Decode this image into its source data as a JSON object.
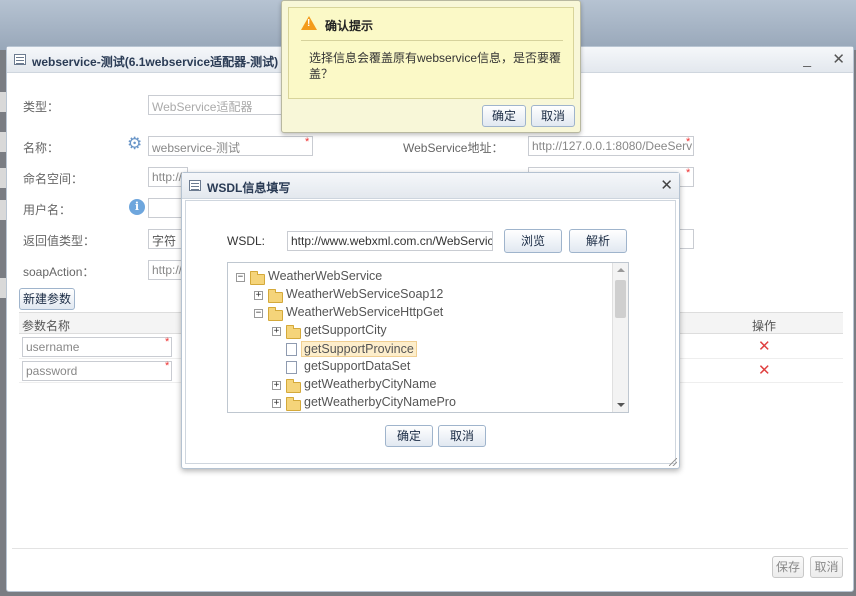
{
  "main_window": {
    "title": "webservice-测试(6.1webservice适配器-测试)",
    "min_icon": "minimize-icon",
    "close_icon": "close-icon",
    "fields": {
      "type": {
        "label": "类型：",
        "value": "WebService适配器"
      },
      "name": {
        "label": "名称：",
        "value": "webservice-测试"
      },
      "namespace": {
        "label": "命名空间：",
        "value": "http://"
      },
      "username": {
        "label": "用户名：",
        "value": ""
      },
      "return_type": {
        "label": "返回值类型：",
        "value": "字符"
      },
      "soap_action": {
        "label": "soapAction：",
        "value": "http://"
      },
      "ws_address": {
        "label": "WebService地址：",
        "value": "http://127.0.0.1:8080/DeeServ"
      }
    },
    "new_param_button": "新建参数",
    "grid": {
      "columns": [
        "参数名称",
        "操作"
      ],
      "rows": [
        {
          "param": "username"
        },
        {
          "param": "password"
        }
      ]
    },
    "save_button": "保存",
    "cancel_button": "取消"
  },
  "confirm_dialog": {
    "title": "确认提示",
    "message": "选择信息会覆盖原有webservice信息，是否要覆盖？",
    "ok_button": "确定",
    "cancel_button": "取消"
  },
  "wsdl_dialog": {
    "title": "WSDL信息填写",
    "wsdl_label": "WSDL:",
    "wsdl_value": "http://www.webxml.com.cn/WebServices/WeatherWebService.asmx?wsdl",
    "browse_button": "浏览",
    "parse_button": "解析",
    "tree": [
      {
        "label": "WeatherWebService",
        "kind": "folder",
        "expander": "−"
      },
      {
        "label": "WeatherWebServiceSoap12",
        "kind": "folder",
        "expander": "+"
      },
      {
        "label": "WeatherWebServiceHttpGet",
        "kind": "folder",
        "expander": "−"
      },
      {
        "label": "getSupportCity",
        "kind": "folder",
        "expander": "+"
      },
      {
        "label": "getSupportProvince",
        "kind": "file",
        "selected": true
      },
      {
        "label": "getSupportDataSet",
        "kind": "file"
      },
      {
        "label": "getWeatherbyCityName",
        "kind": "folder",
        "expander": "+"
      },
      {
        "label": "getWeatherbyCityNamePro",
        "kind": "folder",
        "expander": "+"
      }
    ],
    "ok_button": "确定",
    "cancel_button": "取消"
  }
}
